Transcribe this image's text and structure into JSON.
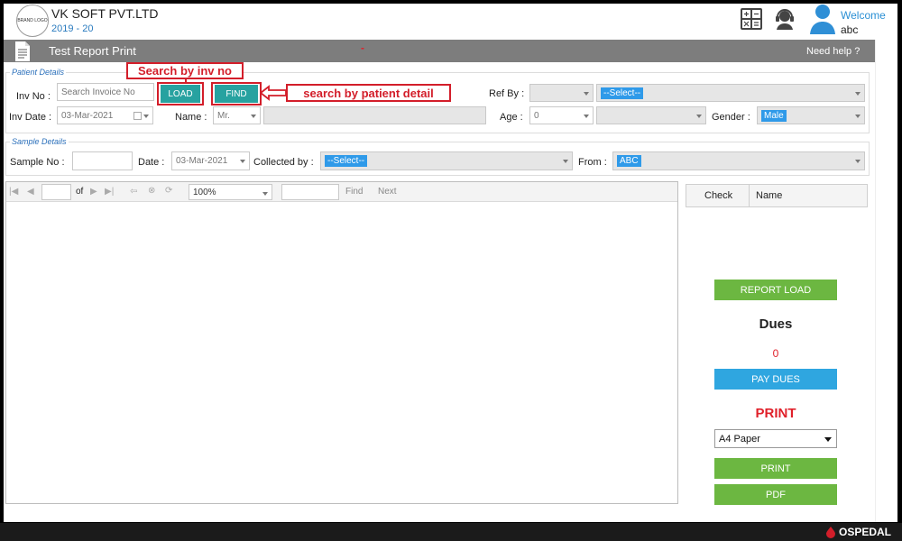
{
  "header": {
    "logo_text": "BRAND LOGO",
    "company": "VK SOFT PVT.LTD",
    "year": "2019 - 20",
    "welcome": "Welcome",
    "user": "abc"
  },
  "titlebar": {
    "title": "Test Report Print",
    "help": "Need help ?",
    "marker": "-"
  },
  "patient": {
    "legend": "Patient Details",
    "inv_no_label": "Inv No :",
    "inv_no_placeholder": "Search Invoice No",
    "load": "LOAD",
    "find": "FIND",
    "ref_by_label": "Ref By :",
    "ref_by_value": "--Select--",
    "inv_date_label": "Inv Date :",
    "inv_date": "03-Mar-2021",
    "name_label": "Name :",
    "title_value": "Mr.",
    "age_label": "Age :",
    "age_value": "0",
    "gender_label": "Gender :",
    "gender_value": "Male"
  },
  "annotations": {
    "search_inv": "Search by inv no",
    "search_patient": "search by patient detail"
  },
  "sample": {
    "legend": "Sample Details",
    "sample_no_label": "Sample No :",
    "date_label": "Date :",
    "date": "03-Mar-2021",
    "collected_label": "Collected by :",
    "collected_value": "--Select--",
    "from_label": "From :",
    "from_value": "ABC"
  },
  "viewer": {
    "of": "of",
    "zoom": "100%",
    "find": "Find",
    "next": "Next"
  },
  "panel": {
    "col_check": "Check",
    "col_name": "Name",
    "report_load": "REPORT LOAD",
    "dues_title": "Dues",
    "dues_value": "0",
    "pay_dues": "PAY DUES",
    "print_title": "PRINT",
    "paper": "A4 Paper",
    "print": "PRINT",
    "pdf": "PDF"
  },
  "footer": {
    "brand": "OSPEDAL"
  },
  "colors": {
    "accent_blue": "#2fa6e0",
    "teal": "#27a2a0",
    "green": "#6cb741",
    "annotation_red": "#d31e2a"
  }
}
